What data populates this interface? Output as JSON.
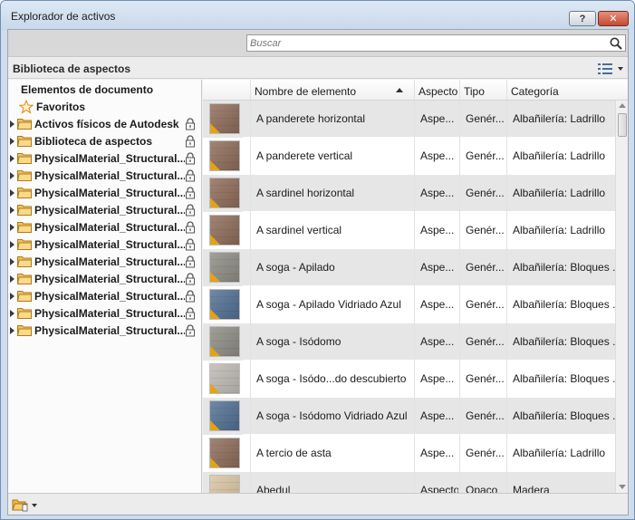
{
  "window": {
    "title": "Explorador de activos",
    "help_label": "?",
    "close_label": "✕"
  },
  "search": {
    "placeholder": "Buscar",
    "value": ""
  },
  "library_bar": {
    "title": "Biblioteca de aspectos"
  },
  "left_tree": {
    "document_heading": "Elementos de documento",
    "favorites_label": "Favoritos",
    "items": [
      {
        "label": "Activos físicos de Autodesk",
        "locked": true
      },
      {
        "label": "Biblioteca de aspectos",
        "locked": true
      },
      {
        "label": "PhysicalMaterial_Structural...",
        "locked": true
      },
      {
        "label": "PhysicalMaterial_Structural...",
        "locked": true
      },
      {
        "label": "PhysicalMaterial_Structural...",
        "locked": true
      },
      {
        "label": "PhysicalMaterial_Structural...",
        "locked": true
      },
      {
        "label": "PhysicalMaterial_Structural...",
        "locked": true
      },
      {
        "label": "PhysicalMaterial_Structural...",
        "locked": true
      },
      {
        "label": "PhysicalMaterial_Structural...",
        "locked": true
      },
      {
        "label": "PhysicalMaterial_Structural...",
        "locked": true
      },
      {
        "label": "PhysicalMaterial_Structural...",
        "locked": true
      },
      {
        "label": "PhysicalMaterial_Structural...",
        "locked": true
      },
      {
        "label": "PhysicalMaterial_Structural...",
        "locked": true
      }
    ]
  },
  "table": {
    "columns": [
      "Nombre de elemento",
      "Aspecto",
      "Tipo",
      "Categoría"
    ],
    "rows": [
      {
        "name": "A panderete horizontal",
        "aspect": "Aspe...",
        "type": "Genér...",
        "category": "Albañilería: Ladrillo",
        "swatch": "brick"
      },
      {
        "name": "A panderete vertical",
        "aspect": "Aspe...",
        "type": "Genér...",
        "category": "Albañilería: Ladrillo",
        "swatch": "brick"
      },
      {
        "name": "A sardinel horizontal",
        "aspect": "Aspe...",
        "type": "Genér...",
        "category": "Albañilería: Ladrillo",
        "swatch": "brick"
      },
      {
        "name": "A sardinel vertical",
        "aspect": "Aspe...",
        "type": "Genér...",
        "category": "Albañilería: Ladrillo",
        "swatch": "brick"
      },
      {
        "name": "A soga - Apilado",
        "aspect": "Aspe...",
        "type": "Genér...",
        "category": "Albañilería: Bloques ...",
        "swatch": "gray"
      },
      {
        "name": "A soga - Apilado Vidriado Azul",
        "aspect": "Aspe...",
        "type": "Genér...",
        "category": "Albañilería: Bloques ...",
        "swatch": "blue"
      },
      {
        "name": "A soga - Isódomo",
        "aspect": "Aspe...",
        "type": "Genér...",
        "category": "Albañilería: Bloques ...",
        "swatch": "gray"
      },
      {
        "name": "A soga - Isódo...do descubierto",
        "aspect": "Aspe...",
        "type": "Genér...",
        "category": "Albañilería: Bloques ...",
        "swatch": "light"
      },
      {
        "name": "A soga - Isódomo Vidriado Azul",
        "aspect": "Aspe...",
        "type": "Genér...",
        "category": "Albañilería: Bloques ...",
        "swatch": "blue"
      },
      {
        "name": "A tercio de asta",
        "aspect": "Aspe...",
        "type": "Genér...",
        "category": "Albañilería: Ladrillo",
        "swatch": "brick"
      },
      {
        "name": "Abedul",
        "aspect": "Aspecto",
        "type": "Opaco",
        "category": "Madera",
        "swatch": "wood"
      }
    ]
  },
  "colors": {
    "brick": "#8d6a57",
    "gray": "#8c8c83",
    "blue": "#4f6f92",
    "light": "#bdb9b3",
    "wood": "#d9c4a2",
    "badge": "#e3a21a"
  }
}
